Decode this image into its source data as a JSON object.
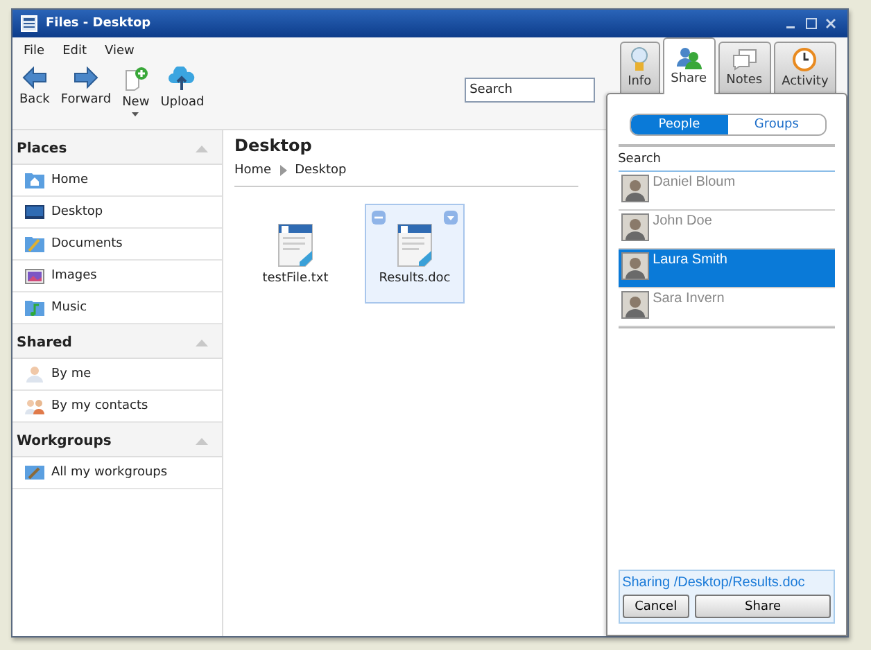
{
  "window": {
    "title": "Files - Desktop"
  },
  "menu": [
    "File",
    "Edit",
    "View"
  ],
  "toolbar": [
    {
      "label": "Back",
      "kind": "back"
    },
    {
      "label": "Forward",
      "kind": "forward"
    },
    {
      "label": "New",
      "kind": "new"
    },
    {
      "label": "Upload",
      "kind": "upload"
    }
  ],
  "search": {
    "placeholder": "Search"
  },
  "sidebar": [
    {
      "title": "Places",
      "items": [
        {
          "label": "Home",
          "kind": "home"
        },
        {
          "label": "Desktop",
          "kind": "desktop"
        },
        {
          "label": "Documents",
          "kind": "documents"
        },
        {
          "label": "Images",
          "kind": "images"
        },
        {
          "label": "Music",
          "kind": "music"
        }
      ]
    },
    {
      "title": "Shared",
      "items": [
        {
          "label": "By me",
          "kind": "person"
        },
        {
          "label": "By my contacts",
          "kind": "people"
        }
      ]
    },
    {
      "title": "Workgroups",
      "items": [
        {
          "label": "All my workgroups",
          "kind": "workgroup"
        }
      ]
    }
  ],
  "content": {
    "title": "Desktop",
    "breadcrumb": [
      "Home",
      "Desktop"
    ],
    "files": [
      {
        "name": "testFile.txt",
        "selected": false
      },
      {
        "name": "Results.doc",
        "selected": true
      }
    ]
  },
  "tabs": [
    {
      "label": "Info",
      "kind": "info",
      "selected": false
    },
    {
      "label": "Share",
      "kind": "share",
      "selected": true
    },
    {
      "label": "Notes",
      "kind": "notes",
      "selected": false
    },
    {
      "label": "Activity",
      "kind": "activity",
      "selected": false
    }
  ],
  "share": {
    "toggle": [
      {
        "label": "People",
        "selected": true
      },
      {
        "label": "Groups",
        "selected": false
      }
    ],
    "search_label": "Search",
    "people": [
      {
        "name": "Daniel Bloum",
        "selected": false
      },
      {
        "name": "John Doe",
        "selected": false
      },
      {
        "name": "Laura Smith",
        "selected": true
      },
      {
        "name": "Sara Invern",
        "selected": false
      }
    ],
    "status": "Sharing /Desktop/Results.doc",
    "buttons": [
      "Cancel",
      "Share"
    ]
  }
}
